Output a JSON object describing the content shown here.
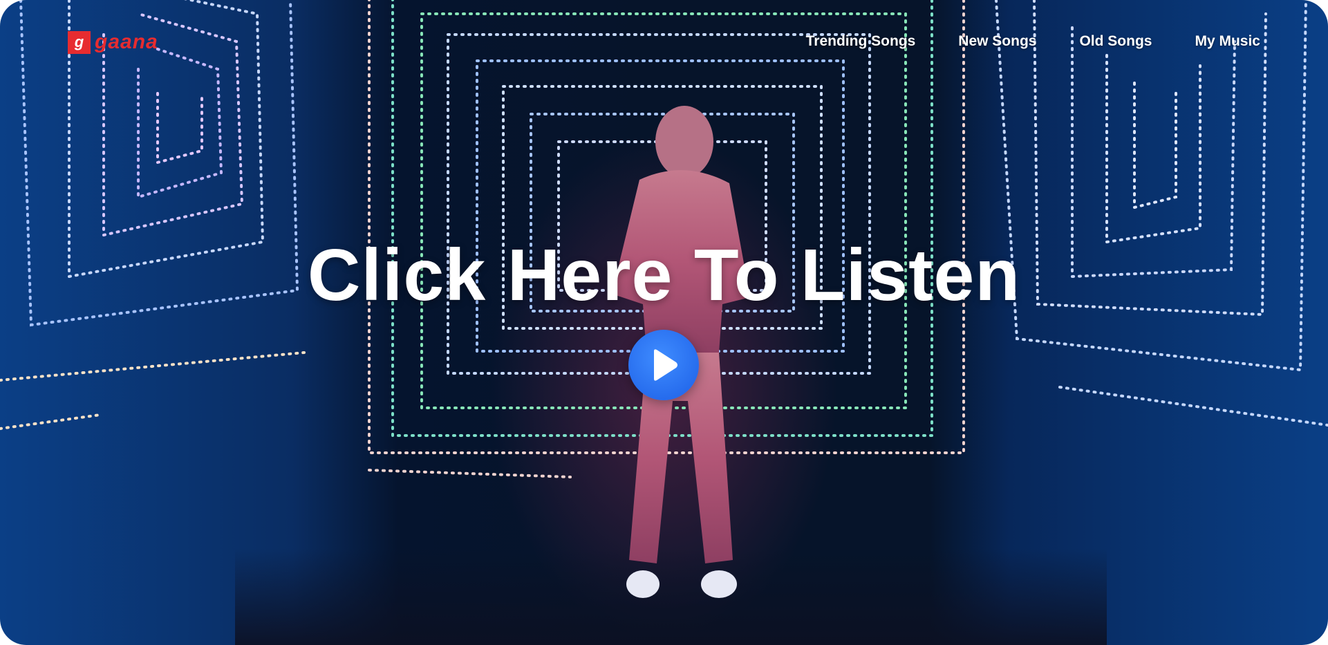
{
  "brand": {
    "logo_letter": "g",
    "logo_text": "gaana",
    "color": "#e72c30"
  },
  "nav": {
    "items": [
      {
        "label": "Trending Songs"
      },
      {
        "label": "New Songs"
      },
      {
        "label": "Old Songs"
      },
      {
        "label": "My Music"
      }
    ]
  },
  "hero": {
    "title": "Click Here To Listen",
    "play_icon": "play-icon",
    "play_color": "#2a6ff2"
  }
}
